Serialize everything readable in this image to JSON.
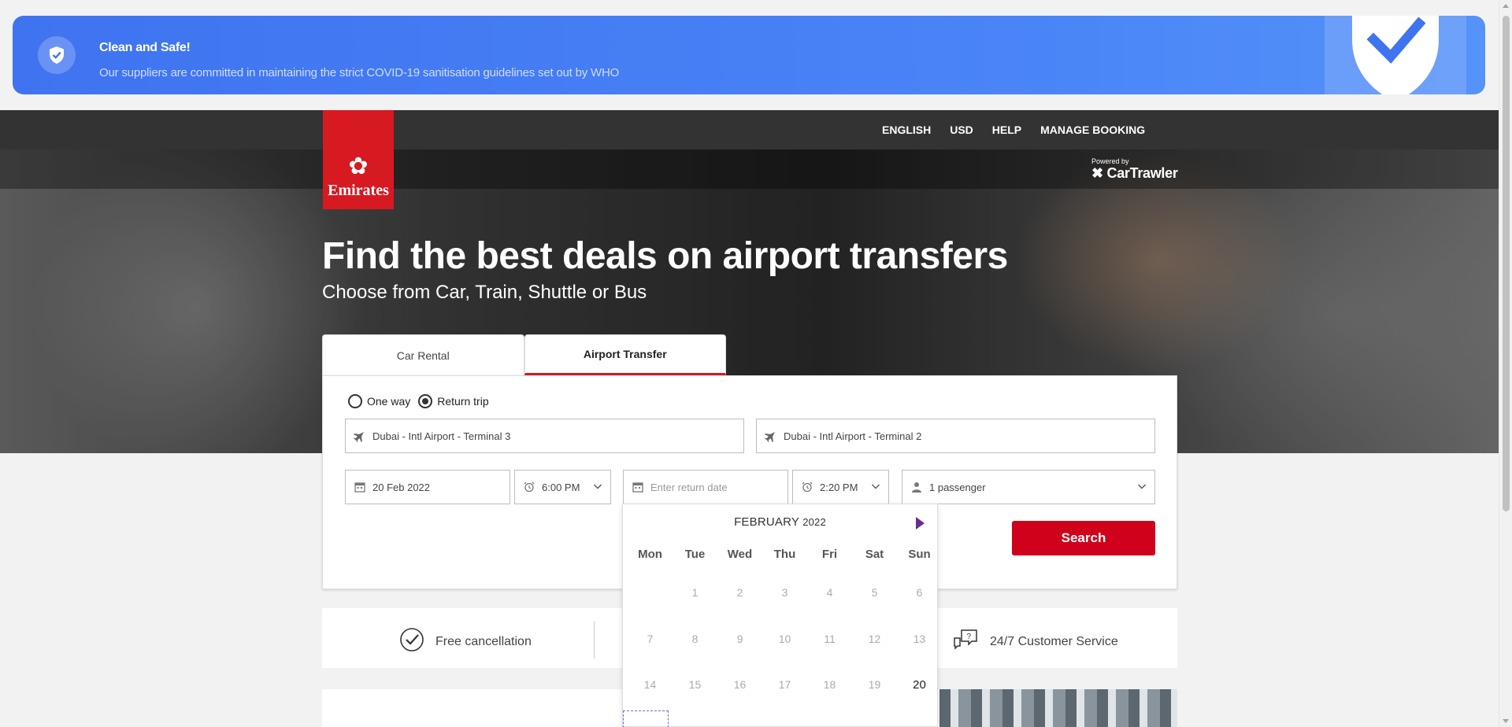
{
  "banner": {
    "title": "Clean and Safe!",
    "subtitle": "Our suppliers are committed in maintaining the strict COVID-19 sanitisation guidelines set out by WHO",
    "icon": "shield-check-icon"
  },
  "nav": {
    "items": [
      "ENGLISH",
      "USD",
      "HELP",
      "MANAGE BOOKING"
    ]
  },
  "brand": {
    "logo_text": "Emirates",
    "powered_by": "Powered by",
    "partner": "CarTrawler"
  },
  "hero": {
    "headline": "Find the best deals on airport transfers",
    "subheadline": "Choose from Car, Train, Shuttle or Bus"
  },
  "tabs": [
    {
      "label": "Car Rental",
      "active": false
    },
    {
      "label": "Airport Transfer",
      "active": true
    }
  ],
  "trip": {
    "one_way": "One way",
    "return_trip": "Return trip",
    "selected": "Return trip"
  },
  "form": {
    "pickup": "Dubai - Intl Airport - Terminal 3",
    "dropoff": "Dubai - Intl Airport - Terminal 2",
    "date": "20 Feb 2022",
    "time": "6:00 PM",
    "return_date_placeholder": "Enter return date",
    "return_time": "2:20 PM",
    "passengers": "1 passenger",
    "search_label": "Search"
  },
  "calendar": {
    "month": "FEBRUARY",
    "year": "2022",
    "weekdays": [
      "Mon",
      "Tue",
      "Wed",
      "Thu",
      "Fri",
      "Sat",
      "Sun"
    ],
    "days": [
      {
        "d": "",
        "avail": false
      },
      {
        "d": "1",
        "avail": false
      },
      {
        "d": "2",
        "avail": false
      },
      {
        "d": "3",
        "avail": false
      },
      {
        "d": "4",
        "avail": false
      },
      {
        "d": "5",
        "avail": false
      },
      {
        "d": "6",
        "avail": false
      },
      {
        "d": "7",
        "avail": false
      },
      {
        "d": "8",
        "avail": false
      },
      {
        "d": "9",
        "avail": false
      },
      {
        "d": "10",
        "avail": false
      },
      {
        "d": "11",
        "avail": false
      },
      {
        "d": "12",
        "avail": false
      },
      {
        "d": "13",
        "avail": false
      },
      {
        "d": "14",
        "avail": false
      },
      {
        "d": "15",
        "avail": false
      },
      {
        "d": "16",
        "avail": false
      },
      {
        "d": "17",
        "avail": false
      },
      {
        "d": "18",
        "avail": false
      },
      {
        "d": "19",
        "avail": false
      },
      {
        "d": "20",
        "avail": true
      }
    ]
  },
  "features": {
    "free_cancellation": "Free cancellation",
    "customer_service": "24/7 Customer Service"
  },
  "colors": {
    "brand_red": "#d71921",
    "banner_blue": "#4a85f7",
    "calendar_arrow": "#6a2c91"
  }
}
